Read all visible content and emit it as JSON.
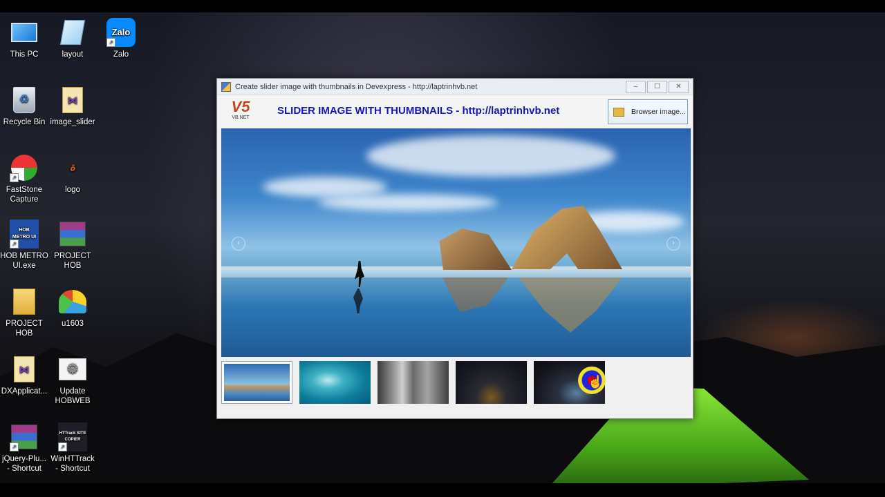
{
  "desktop": {
    "icons": [
      {
        "label": "This PC",
        "icon": "monitor-icon"
      },
      {
        "label": "layout",
        "icon": "notepad-icon"
      },
      {
        "label": "Zalo",
        "icon": "zalo-icon",
        "badge": "Zalo"
      },
      {
        "label": "Recycle Bin",
        "icon": "recycle-bin-icon"
      },
      {
        "label": "image_slider",
        "icon": "visual-studio-file-icon"
      },
      {
        "label": "FastStone Capture",
        "icon": "faststone-icon"
      },
      {
        "label": "logo",
        "icon": "logo-file-icon"
      },
      {
        "label": "HOB METRO UI.exe",
        "icon": "hob-metro-icon",
        "badge": "HOB METRO UI"
      },
      {
        "label": "PROJECT HOB",
        "icon": "winrar-archive-icon"
      },
      {
        "label": "PROJECT HOB",
        "icon": "folder-icon"
      },
      {
        "label": "u1603",
        "icon": "application-icon"
      },
      {
        "label": "DXApplicat...",
        "icon": "visual-studio-file-icon"
      },
      {
        "label": "Update HOBWEB",
        "icon": "gear-icon"
      },
      {
        "label": "jQuery-Plu... - Shortcut",
        "icon": "winrar-archive-icon"
      },
      {
        "label": "WinHTTrack - Shortcut",
        "icon": "httrack-icon",
        "badge": "HTTrack SITE COPIER"
      }
    ]
  },
  "window": {
    "title": "Create slider image with thumbnails in Devexpress - http://laptrinhvb.net",
    "controls": {
      "minimize": "–",
      "maximize": "☐",
      "close": "✕"
    },
    "logo": {
      "mark": "V5",
      "text": "VB.NET"
    },
    "heading": "SLIDER IMAGE WITH THUMBNAILS - http://laptrinhvb.net",
    "browse_button": "Browser image...",
    "slider": {
      "prev_arrow": "‹",
      "next_arrow": "›",
      "current_image": "beach-rocks-runner"
    },
    "thumbnails": [
      {
        "name": "beach-rocks",
        "selected": true
      },
      {
        "name": "underwater-swimmer",
        "selected": false
      },
      {
        "name": "rock-cliff",
        "selected": false
      },
      {
        "name": "night-sky-tent",
        "selected": false
      },
      {
        "name": "night-tent",
        "selected": false
      }
    ]
  },
  "colors": {
    "heading": "#1515b8",
    "titlebar": "#e9eef5",
    "window_bg": "#f0f0f0"
  }
}
